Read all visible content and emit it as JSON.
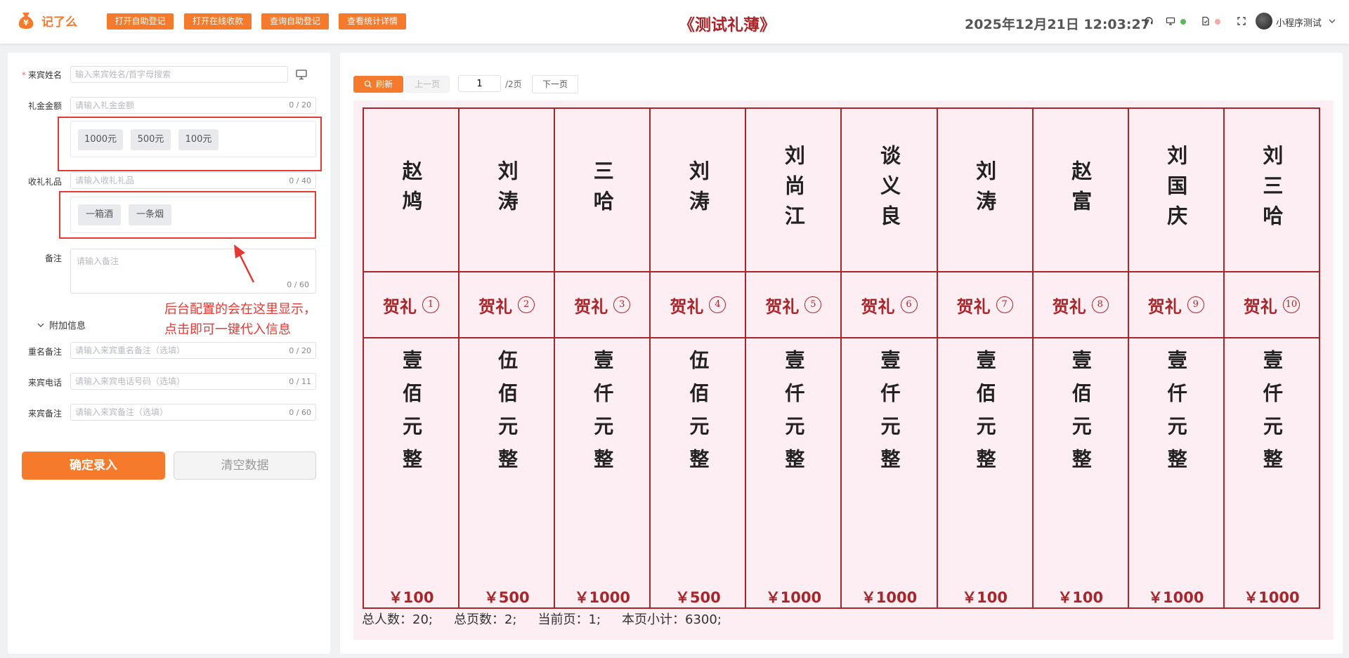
{
  "header": {
    "app_name": "记了么",
    "logo_icon": "money-bag-icon",
    "buttons": [
      "打开自助登记",
      "打开在线收款",
      "查询自助登记",
      "查看统计详情"
    ],
    "book_title": "《测试礼薄》",
    "datetime": "2025年12月21日 12:03:27",
    "user_name": "小程序测试",
    "status_colors": {
      "online": "#5cb85c",
      "offline": "#f3a9a9"
    }
  },
  "form": {
    "guest_name": {
      "label": "来宾姓名",
      "placeholder": "输入来宾姓名/首字母搜索"
    },
    "gift_money": {
      "label": "礼金金额",
      "placeholder": "请输入礼金金额",
      "counter": "0 / 20",
      "presets": [
        "1000元",
        "500元",
        "100元"
      ]
    },
    "gift_item": {
      "label": "收礼礼品",
      "placeholder": "请输入收礼礼品",
      "counter": "0 / 40",
      "presets": [
        "一箱酒",
        "一条烟"
      ]
    },
    "remark": {
      "label": "备注",
      "placeholder": "请输入备注",
      "counter": "0 / 60"
    },
    "extra_toggle": "附加信息",
    "dup_remark": {
      "label": "重名备注",
      "placeholder": "请输入来宾重名备注（选填）",
      "counter": "0 / 20"
    },
    "phone": {
      "label": "来宾电话",
      "placeholder": "请输入来宾电话号码（选填）",
      "counter": "0 / 11"
    },
    "guest_remark": {
      "label": "来宾备注",
      "placeholder": "请输入来宾备注（选填）",
      "counter": "0 / 60"
    },
    "submit": "确定录入",
    "clear": "清空数据"
  },
  "annotation": [
    "后台配置的会在这里显示，",
    "点击即可一键代入信息"
  ],
  "pager": {
    "refresh": "刷新",
    "prev": "上一页",
    "current": "1",
    "total": "/2页",
    "next": "下一页"
  },
  "gift_entries": [
    {
      "name": "赵鸠",
      "tag": "贺礼",
      "num": "1",
      "amount_cn": "壹佰元整",
      "amount": "￥100"
    },
    {
      "name": "刘涛",
      "tag": "贺礼",
      "num": "2",
      "amount_cn": "伍佰元整",
      "amount": "￥500"
    },
    {
      "name": "三哈",
      "tag": "贺礼",
      "num": "3",
      "amount_cn": "壹仟元整",
      "amount": "￥1000"
    },
    {
      "name": "刘涛",
      "tag": "贺礼",
      "num": "4",
      "amount_cn": "伍佰元整",
      "amount": "￥500"
    },
    {
      "name": "刘尚江",
      "tag": "贺礼",
      "num": "5",
      "amount_cn": "壹仟元整",
      "amount": "￥1000"
    },
    {
      "name": "谈义良",
      "tag": "贺礼",
      "num": "6",
      "amount_cn": "壹仟元整",
      "amount": "￥1000"
    },
    {
      "name": "刘涛",
      "tag": "贺礼",
      "num": "7",
      "amount_cn": "壹佰元整",
      "amount": "￥100"
    },
    {
      "name": "赵富",
      "tag": "贺礼",
      "num": "8",
      "amount_cn": "壹佰元整",
      "amount": "￥100"
    },
    {
      "name": "刘国庆",
      "tag": "贺礼",
      "num": "9",
      "amount_cn": "壹仟元整",
      "amount": "￥1000"
    },
    {
      "name": "刘三哈",
      "tag": "贺礼",
      "num": "10",
      "amount_cn": "壹仟元整",
      "amount": "￥1000"
    }
  ],
  "summary": {
    "total_people": "总人数：20;",
    "total_pages": "总页数：2;",
    "current_page": "当前页：1;",
    "page_subtotal": "本页小计：6300;"
  }
}
